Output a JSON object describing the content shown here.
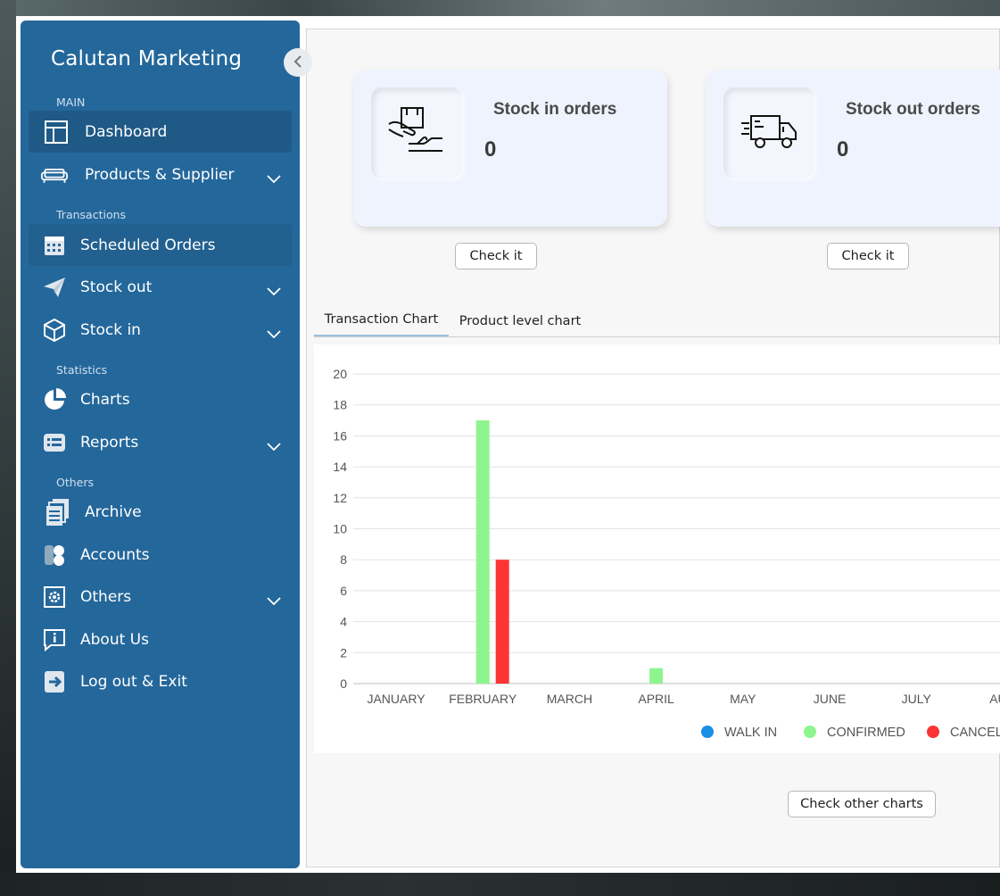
{
  "brand": "Calutan Marketing",
  "sidebar": {
    "sections": {
      "main": "MAIN",
      "transactions": "Transactions",
      "statistics": "Statistics",
      "others": "Others"
    },
    "items": {
      "dashboard": "Dashboard",
      "products_supplier": "Products & Supplier",
      "scheduled_orders": "Scheduled Orders",
      "stock_out": "Stock out",
      "stock_in": "Stock in",
      "charts": "Charts",
      "reports": "Reports",
      "archive": "Archive",
      "accounts": "Accounts",
      "others": "Others",
      "about_us": "About Us",
      "logout": "Log out & Exit"
    }
  },
  "cards": {
    "stock_in": {
      "title": "Stock in orders",
      "value": "0",
      "button": "Check it"
    },
    "stock_out": {
      "title": "Stock out orders",
      "value": "0",
      "button": "Check it"
    }
  },
  "tabs": {
    "transaction_chart": "Transaction Chart",
    "product_level_chart": "Product level chart"
  },
  "check_other_charts": "Check other charts",
  "colors": {
    "sidebar": "#24679b",
    "walk_in": "#1a8fe6",
    "confirmed": "#8ef58e",
    "cancelled": "#fb3535"
  },
  "chart_data": {
    "type": "bar",
    "categories": [
      "JANUARY",
      "FEBRUARY",
      "MARCH",
      "APRIL",
      "MAY",
      "JUNE",
      "JULY",
      "AUG"
    ],
    "series": [
      {
        "name": "WALK IN",
        "values": [
          0,
          0,
          0,
          0,
          0,
          0,
          0,
          0
        ]
      },
      {
        "name": "CONFIRMED",
        "values": [
          0,
          17,
          0,
          1,
          0,
          0,
          0,
          0
        ]
      },
      {
        "name": "CANCEL",
        "values": [
          0,
          8,
          0,
          0,
          0,
          0,
          0,
          0
        ]
      }
    ],
    "ylim": [
      0,
      20
    ],
    "yticks": [
      0,
      2,
      4,
      6,
      8,
      10,
      12,
      14,
      16,
      18,
      20
    ],
    "grid": true,
    "legend_position": "bottom"
  }
}
